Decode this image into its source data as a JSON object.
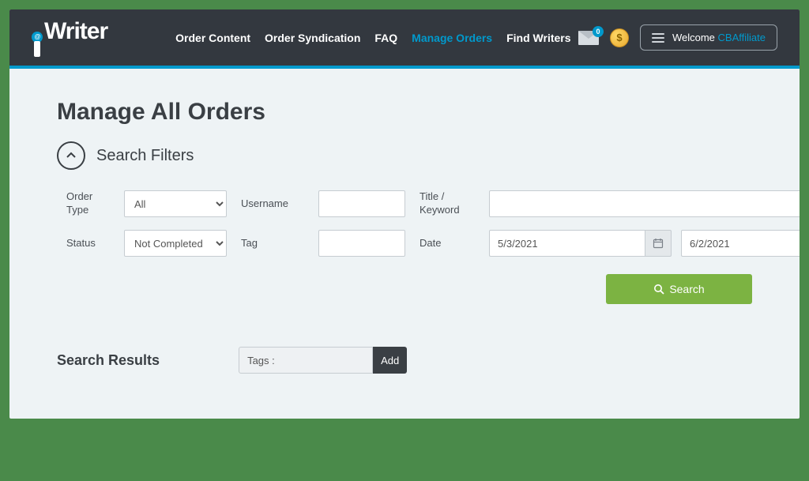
{
  "logo": {
    "text": "Writer",
    "dot_char": "@"
  },
  "nav": {
    "items": [
      {
        "label": "Order Content",
        "active": false
      },
      {
        "label": "Order Syndication",
        "active": false
      },
      {
        "label": "FAQ",
        "active": false
      },
      {
        "label": "Manage Orders",
        "active": true
      },
      {
        "label": "Find Writers",
        "active": false
      }
    ],
    "mail_badge": "0",
    "coin_symbol": "$",
    "welcome_prefix": "Welcome ",
    "welcome_user": "CBAffiliate"
  },
  "page": {
    "title": "Manage All Orders",
    "filters_title": "Search Filters"
  },
  "filters": {
    "order_type_label": "Order Type",
    "order_type_value": "All",
    "username_label": "Username",
    "username_value": "",
    "title_keyword_label": "Title / Keyword",
    "title_keyword_value": "",
    "status_label": "Status",
    "status_value": "Not Completed",
    "tag_label": "Tag",
    "tag_value": "",
    "date_label": "Date",
    "date_from": "5/3/2021",
    "date_to": "6/2/2021",
    "search_button": "Search"
  },
  "results": {
    "title": "Search Results",
    "tags_placeholder": "Tags :",
    "add_button": "Add"
  }
}
